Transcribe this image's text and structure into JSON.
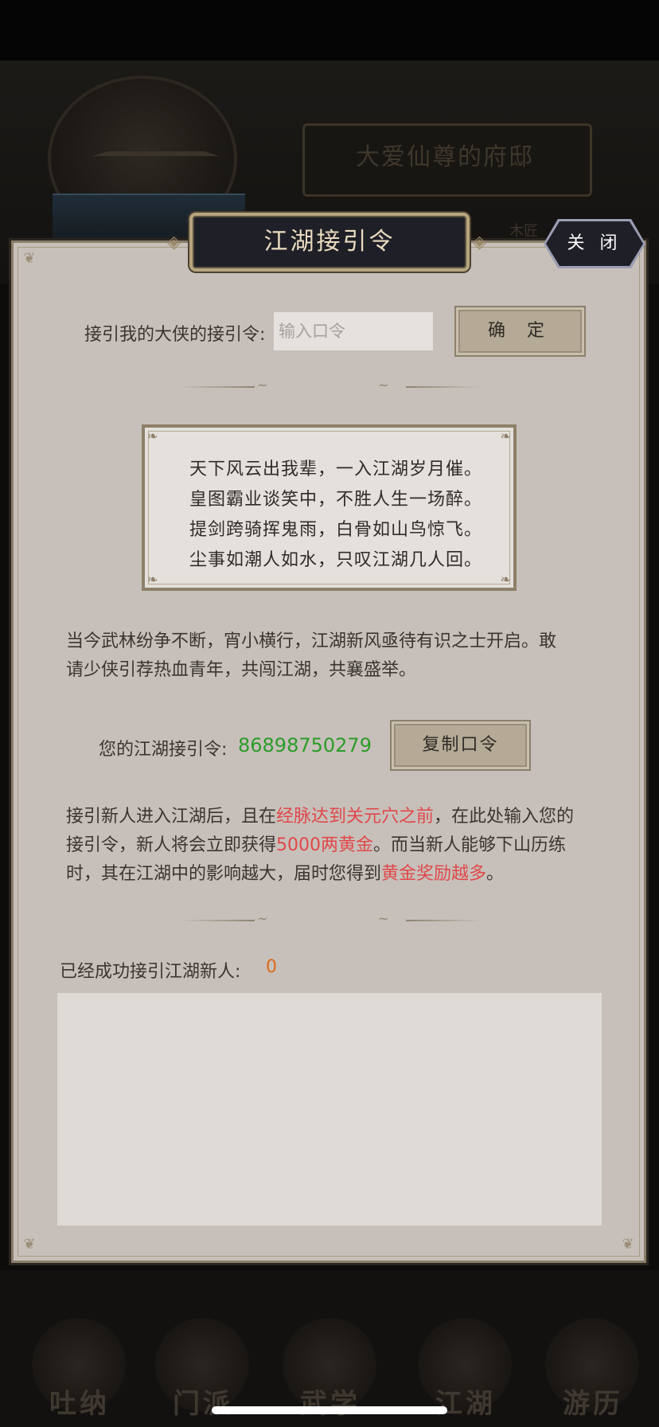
{
  "background": {
    "mansion_title": "大爱仙尊的府邸",
    "side_label": "木匠",
    "tabs": [
      "吐纳",
      "门派",
      "武学",
      "江湖",
      "游历"
    ]
  },
  "modal": {
    "title": "江湖接引令",
    "close_label": "关 闭",
    "invite_label": "接引我的大侠的接引令:",
    "invite_placeholder": "输入口令",
    "confirm_label": "确 定",
    "poem": [
      "天下风云出我辈，一入江湖岁月催。",
      "皇图霸业谈笑中，不胜人生一场醉。",
      "提剑跨骑挥鬼雨，白骨如山鸟惊飞。",
      "尘事如潮人如水，只叹江湖几人回。"
    ],
    "intro_lines": [
      "当今武林纷争不断，宵小横行，江湖新风亟待有识之士开启。敢",
      "请少侠引荐热血青年，共闯江湖，共襄盛举。"
    ],
    "your_code_label": "您的江湖接引令:",
    "your_code": "86898750279",
    "copy_label": "复制口令",
    "reward": {
      "l1_a": "接引新人进入江湖后，且在",
      "l1_red": "经脉达到关元穴之前",
      "l1_b": "，在此处输入您的",
      "l2_a": "接引令，新人将会立即获得",
      "l2_red": "5000两黄金",
      "l2_b": "。而当新人能够下山历练",
      "l3_a": "时，其在江湖中的影响越大，届时您得到",
      "l3_red": "黄金奖励越多",
      "l3_b": "。"
    },
    "success_label": "已经成功接引江湖新人:",
    "success_count": "0"
  }
}
